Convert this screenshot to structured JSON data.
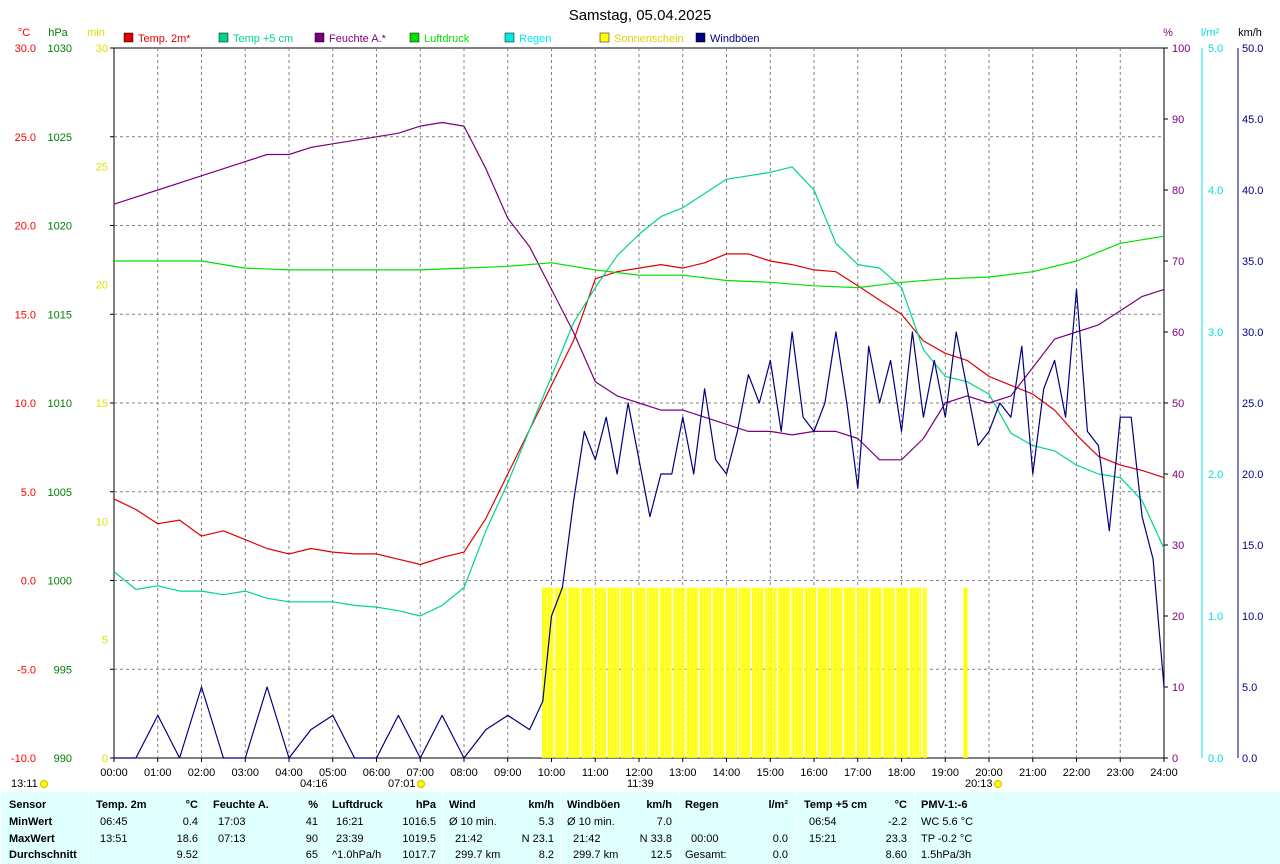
{
  "title": "Samstag, 05.04.2025",
  "colors": {
    "temp2m": "#e00000",
    "temp5cm": "#00d48a",
    "humidity": "#7a007a",
    "pressure": "#00e000",
    "rain": "#00e8e8",
    "sunshine": "#ffff00",
    "gusts": "#000080"
  },
  "axes": {
    "temp_unit": "°C",
    "pressure_unit": "hPa",
    "sun_unit": "min",
    "humidity_unit": "%",
    "rain_unit": "l/m²",
    "wind_unit": "km/h",
    "temp_ticks": [
      "30.0",
      "25.0",
      "20.0",
      "15.0",
      "10.0",
      "5.0",
      "0.0",
      "-5.0",
      "-10.0"
    ],
    "pressure_ticks": [
      "1030",
      "1025",
      "1020",
      "1015",
      "1010",
      "1005",
      "1000",
      "995",
      "990"
    ],
    "sun_ticks": [
      "30",
      "25",
      "20",
      "15",
      "10",
      "5",
      "0"
    ],
    "humidity_ticks": [
      "100",
      "90",
      "80",
      "70",
      "60",
      "50",
      "40",
      "30",
      "20",
      "10",
      "0"
    ],
    "rain_ticks": [
      "5.0",
      "4.0",
      "3.0",
      "2.0",
      "1.0",
      "0.0"
    ],
    "wind_ticks": [
      "50.0",
      "45.0",
      "40.0",
      "35.0",
      "30.0",
      "25.0",
      "20.0",
      "15.0",
      "10.0",
      "5.0",
      "0.0"
    ],
    "time_ticks": [
      "00:00",
      "01:00",
      "02:00",
      "03:00",
      "04:00",
      "05:00",
      "06:00",
      "07:00",
      "08:00",
      "09:00",
      "10:00",
      "11:00",
      "12:00",
      "13:00",
      "14:00",
      "15:00",
      "16:00",
      "17:00",
      "18:00",
      "19:00",
      "20:00",
      "21:00",
      "22:00",
      "23:00",
      "24:00"
    ]
  },
  "legend": [
    {
      "label": "Temp. 2m*",
      "color": "#e00000"
    },
    {
      "label": "Temp +5 cm",
      "color": "#00d48a"
    },
    {
      "label": "Feuchte A.*",
      "color": "#7a007a"
    },
    {
      "label": "Luftdruck",
      "color": "#00e000"
    },
    {
      "label": "Regen",
      "color": "#00e8e8"
    },
    {
      "label": "Sonnenschein",
      "color": "#ffff00"
    },
    {
      "label": "Windböen",
      "color": "#000080"
    }
  ],
  "markers": {
    "moonrise": "13:11",
    "sunrise": "04:16",
    "dawn": "07:01",
    "noon": "11:39",
    "sunset": "20:13"
  },
  "chart_data": {
    "type": "line",
    "x_unit": "hour of day",
    "xlim": [
      0,
      24
    ],
    "series": [
      {
        "name": "Temp. 2m*",
        "unit": "°C",
        "x": [
          0,
          0.5,
          1,
          1.5,
          2,
          2.5,
          3,
          3.5,
          4,
          4.5,
          5,
          5.5,
          6,
          6.5,
          7,
          7.5,
          8,
          8.5,
          9,
          9.5,
          10,
          10.5,
          11,
          11.5,
          12,
          12.5,
          13,
          13.5,
          14,
          14.5,
          15,
          15.5,
          16,
          16.5,
          17,
          17.5,
          18,
          18.5,
          19,
          19.5,
          20,
          20.5,
          21,
          21.5,
          22,
          22.5,
          23,
          23.5,
          24
        ],
        "values": [
          4.6,
          4.0,
          3.2,
          3.4,
          2.5,
          2.8,
          2.3,
          1.8,
          1.5,
          1.8,
          1.6,
          1.5,
          1.5,
          1.2,
          0.9,
          1.3,
          1.6,
          3.5,
          6.0,
          8.5,
          11.0,
          13.5,
          17.0,
          17.4,
          17.6,
          17.8,
          17.6,
          17.9,
          18.4,
          18.4,
          18.0,
          17.8,
          17.5,
          17.4,
          16.6,
          15.8,
          15.0,
          13.5,
          12.8,
          12.4,
          11.5,
          11.0,
          10.5,
          9.6,
          8.2,
          7.0,
          6.5,
          6.2,
          5.8
        ]
      },
      {
        "name": "Temp +5 cm",
        "unit": "°C",
        "x": [
          0,
          0.5,
          1,
          1.5,
          2,
          2.5,
          3,
          3.5,
          4,
          4.5,
          5,
          5.5,
          6,
          6.5,
          7,
          7.5,
          8,
          8.5,
          9,
          9.5,
          10,
          10.5,
          11,
          11.5,
          12,
          12.5,
          13,
          13.5,
          14,
          14.5,
          15,
          15.5,
          16,
          16.5,
          17,
          17.5,
          18,
          18.5,
          19,
          19.5,
          20,
          20.5,
          21,
          21.5,
          22,
          22.5,
          23,
          23.5,
          24
        ],
        "values": [
          0.5,
          -0.5,
          -0.3,
          -0.6,
          -0.6,
          -0.8,
          -0.6,
          -1.0,
          -1.2,
          -1.2,
          -1.2,
          -1.4,
          -1.5,
          -1.7,
          -2.0,
          -1.4,
          -0.4,
          2.8,
          5.5,
          8.5,
          11.5,
          14.5,
          16.5,
          18.3,
          19.5,
          20.5,
          21.0,
          21.8,
          22.6,
          22.8,
          23.0,
          23.3,
          22.0,
          19.0,
          17.8,
          17.6,
          16.5,
          13.0,
          11.5,
          11.2,
          10.5,
          8.3,
          7.6,
          7.3,
          6.5,
          6.0,
          5.8,
          4.5,
          1.8
        ]
      },
      {
        "name": "Feuchte A.*",
        "unit": "%",
        "x": [
          0,
          0.5,
          1,
          1.5,
          2,
          2.5,
          3,
          3.5,
          4,
          4.5,
          5,
          5.5,
          6,
          6.5,
          7,
          7.5,
          8,
          8.5,
          9,
          9.5,
          10,
          10.5,
          11,
          11.5,
          12,
          12.5,
          13,
          13.5,
          14,
          14.5,
          15,
          15.5,
          16,
          16.5,
          17,
          17.5,
          18,
          18.5,
          19,
          19.5,
          20,
          20.5,
          21,
          21.5,
          22,
          22.5,
          23,
          23.5,
          24
        ],
        "values": [
          78,
          79,
          80,
          81,
          82,
          83,
          84,
          85,
          85,
          86,
          86.5,
          87,
          87.5,
          88,
          89,
          89.5,
          89,
          83,
          76,
          72,
          66,
          60,
          53,
          51,
          50,
          49,
          49,
          48,
          47,
          46,
          46,
          45.5,
          46,
          46,
          45,
          42,
          42,
          45,
          50,
          51,
          50,
          51,
          55,
          59,
          60,
          61,
          63,
          65,
          66
        ]
      },
      {
        "name": "Luftdruck",
        "unit": "hPa",
        "x": [
          0,
          1,
          2,
          3,
          4,
          5,
          6,
          7,
          8,
          9,
          10,
          11,
          12,
          13,
          14,
          15,
          16,
          17,
          18,
          19,
          20,
          21,
          22,
          23,
          24
        ],
        "values": [
          1018.0,
          1018.0,
          1018.0,
          1017.6,
          1017.5,
          1017.5,
          1017.5,
          1017.5,
          1017.6,
          1017.7,
          1017.9,
          1017.5,
          1017.2,
          1017.2,
          1016.9,
          1016.8,
          1016.6,
          1016.5,
          1016.8,
          1017.0,
          1017.1,
          1017.4,
          1018.0,
          1019.0,
          1019.4
        ]
      },
      {
        "name": "Windböen",
        "unit": "km/h",
        "x": [
          0,
          0.5,
          1,
          1.5,
          2,
          2.5,
          3,
          3.5,
          4,
          4.5,
          5,
          5.5,
          6,
          6.5,
          7,
          7.5,
          8,
          8.5,
          9,
          9.5,
          9.8,
          10,
          10.25,
          10.5,
          10.75,
          11,
          11.25,
          11.5,
          11.75,
          12,
          12.25,
          12.5,
          12.75,
          13,
          13.25,
          13.5,
          13.75,
          14,
          14.25,
          14.5,
          14.75,
          15,
          15.25,
          15.5,
          15.75,
          16,
          16.25,
          16.5,
          16.75,
          17,
          17.25,
          17.5,
          17.75,
          18,
          18.25,
          18.5,
          18.75,
          19,
          19.25,
          19.5,
          19.75,
          20,
          20.25,
          20.5,
          20.75,
          21,
          21.25,
          21.5,
          21.75,
          22,
          22.25,
          22.5,
          22.75,
          23,
          23.25,
          23.5,
          23.75,
          24
        ],
        "values": [
          0,
          0,
          3,
          0,
          5,
          0,
          0,
          5,
          0,
          2,
          3,
          0,
          0,
          3,
          0,
          3,
          0,
          2,
          3,
          2,
          4,
          10,
          12,
          18,
          23,
          21,
          24,
          20,
          25,
          21,
          17,
          20,
          20,
          24,
          20,
          26,
          21,
          20,
          23,
          27,
          25,
          28,
          23,
          30,
          24,
          23,
          25,
          30,
          25,
          19,
          29,
          25,
          28,
          23,
          30,
          24,
          28,
          24,
          30,
          26,
          22,
          23,
          25,
          24,
          29,
          20,
          26,
          28,
          24,
          33,
          23,
          22,
          16,
          24,
          24,
          17,
          14,
          5
        ]
      }
    ],
    "sunshine_minutes": {
      "bar_level": 2.4,
      "start": "09:47",
      "end": "18:35",
      "extra": [
        "19:25"
      ]
    }
  },
  "stats": {
    "sensor": {
      "header": "Sensor",
      "min": "MinWert",
      "max": "MaxWert",
      "avg": "Durchschnitt"
    },
    "temp2m": {
      "header": "Temp. 2m",
      "unit": "°C",
      "min_time": "06:45",
      "min_val": "0.4",
      "max_time": "13:51",
      "max_val": "18.6",
      "avg": "9.52"
    },
    "humidity": {
      "header": "Feuchte A.",
      "unit": "%",
      "min_time": "17:03",
      "min_val": "41",
      "max_time": "07:13",
      "max_val": "90",
      "avg": "65"
    },
    "pressure": {
      "header": "Luftdruck",
      "unit": "hPa",
      "min_time": "16:21",
      "min_val": "1016.5",
      "max_time": "23:39",
      "max_val": "1019.5",
      "avg_label": "^1.0hPa/h",
      "avg": "1017.7"
    },
    "wind": {
      "header": "Wind",
      "unit": "km/h",
      "min_label": "Ø 10 min.",
      "min_val": "5.3",
      "max_time": "21:42",
      "max_val": "N 23.1",
      "avg_label": "299.7 km",
      "avg": "8.2"
    },
    "gusts": {
      "header": "Windböen",
      "unit": "km/h",
      "min_label": "Ø 10 min.",
      "min_val": "7.0",
      "max_time": "21:42",
      "max_val": "N 33.8",
      "avg_label": "299.7 km",
      "avg": "12.5"
    },
    "rain": {
      "header": "Regen",
      "unit": "l/m²",
      "max_time": "00:00",
      "max_val": "0.0",
      "avg_label": "Gesamt:",
      "avg": "0.0"
    },
    "temp5cm": {
      "header": "Temp +5 cm",
      "unit": "°C",
      "min_time": "06:54",
      "min_val": "-2.2",
      "max_time": "15:21",
      "max_val": "23.3",
      "avg": "8.60"
    },
    "pmv": {
      "header": "PMV-1:-6",
      "min_val": "WC 5.6 °C",
      "max_val": "TP -0.2 °C",
      "avg": "1.5hPa/3h"
    }
  }
}
